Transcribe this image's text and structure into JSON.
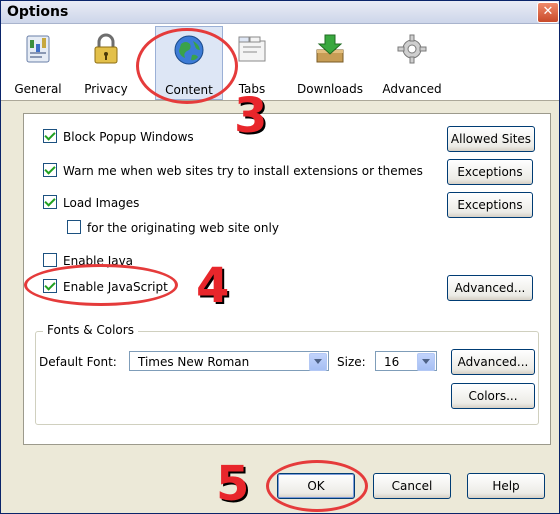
{
  "window": {
    "title": "Options",
    "close_glyph": "✕"
  },
  "toolbar": {
    "tabs": [
      {
        "label": "General",
        "icon": "general-icon"
      },
      {
        "label": "Privacy",
        "icon": "lock-icon"
      },
      {
        "label": "Content",
        "icon": "globe-icon",
        "active": true
      },
      {
        "label": "Tabs",
        "icon": "tabs-icon"
      },
      {
        "label": "Downloads",
        "icon": "download-icon"
      },
      {
        "label": "Advanced",
        "icon": "gear-icon"
      }
    ]
  },
  "content": {
    "block_popups": {
      "label": "Block Popup Windows",
      "checked": true
    },
    "warn_extensions": {
      "label": "Warn me when web sites try to install extensions or themes",
      "checked": true
    },
    "load_images": {
      "label": "Load Images",
      "checked": true
    },
    "originating_only": {
      "label": "for the originating web site only",
      "checked": false
    },
    "enable_java": {
      "label": "Enable Java",
      "checked": false
    },
    "enable_javascript": {
      "label": "Enable JavaScript",
      "checked": true
    },
    "allowed_sites_btn": "Allowed Sites",
    "exceptions_btn_1": "Exceptions",
    "exceptions_btn_2": "Exceptions",
    "advanced_js_btn": "Advanced..."
  },
  "fonts": {
    "group_label": "Fonts & Colors",
    "default_font_label": "Default Font:",
    "default_font_value": "Times New Roman",
    "size_label": "Size:",
    "size_value": "16",
    "advanced_btn": "Advanced...",
    "colors_btn": "Colors..."
  },
  "footer": {
    "ok": "OK",
    "cancel": "Cancel",
    "help": "Help"
  },
  "annotations": {
    "step3": "3",
    "step4": "4",
    "step5": "5"
  },
  "colors": {
    "annotation": "#e8262b",
    "titlebar_border": "#0a246a"
  }
}
